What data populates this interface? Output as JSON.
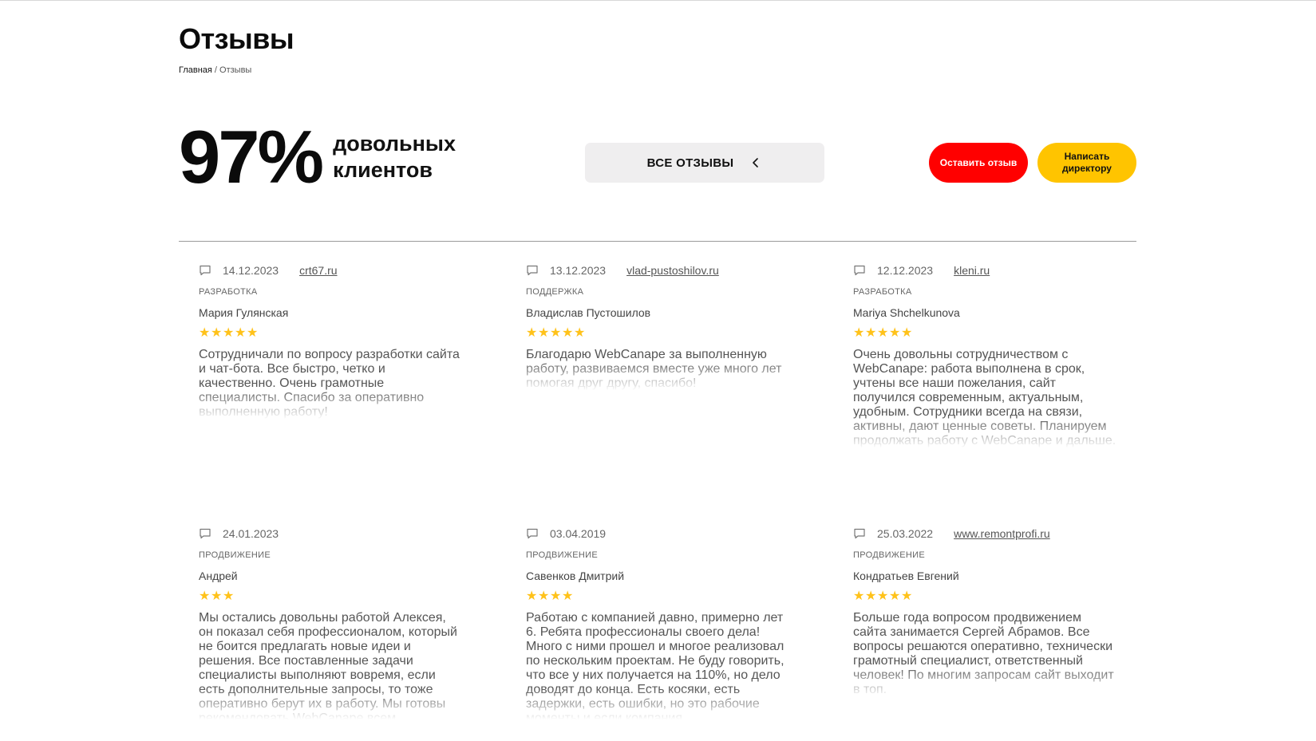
{
  "page": {
    "title": "Отзывы"
  },
  "breadcrumb": {
    "home": "Главная",
    "separator": " / ",
    "current": "Отзывы"
  },
  "stat": {
    "value": "97%",
    "caption_line1": "довольных",
    "caption_line2": "клиентов"
  },
  "filter": {
    "label": "ВСЕ ОТЗЫВЫ",
    "icon": "chevron-left-icon"
  },
  "buttons": {
    "leave_review": "Оставить отзыв",
    "write_director": "Написать директору"
  },
  "colors": {
    "accent_red": "#ff0000",
    "accent_yellow": "#ffc400",
    "star": "#ffc21a",
    "filter_bg": "#efeeef"
  },
  "reviews": [
    {
      "date": "14.12.2023",
      "site": "crt67.ru",
      "category": "РАЗРАБОТКА",
      "author": "Мария Гулянская",
      "rating": 5,
      "text": "Сотрудничали по вопросу разработки сайта и чат-бота. Все быстро, четко и качественно. Очень грамотные специалисты. Спасибо за оперативно выполненную работу!"
    },
    {
      "date": "13.12.2023",
      "site": "vlad-pustoshilov.ru",
      "category": "ПОДДЕРЖКА",
      "author": "Владислав Пустошилов",
      "rating": 5,
      "text": "Благодарю WebCanape за выполненную работу, развиваемся вместе уже много лет помогая друг другу, спасибо!"
    },
    {
      "date": "12.12.2023",
      "site": "kleni.ru",
      "category": "РАЗРАБОТКА",
      "author": "Mariya Shchelkunova",
      "rating": 5,
      "text": "Очень довольны сотрудничеством с WebCanape: работа выполнена в срок, учтены все наши пожелания, сайт получился современным, актуальным, удобным. Сотрудники всегда на связи, активны, дают ценные советы. Планируем продолжать работу с WebCanape и дальше."
    },
    {
      "date": "24.01.2023",
      "site": "",
      "category": "ПРОДВИЖЕНИЕ",
      "author": "Андрей",
      "rating": 3,
      "text": "Мы остались довольны работой Алексея, он показал себя профессионалом, который не боится предлагать новые идеи и решения. Все поставленные задачи специалисты выполняют вовремя, если есть дополнительные запросы, то тоже оперативно берут их в работу. Мы готовы рекомендовать WebCanape всем"
    },
    {
      "date": "03.04.2019",
      "site": "",
      "category": "ПРОДВИЖЕНИЕ",
      "author": "Савенков Дмитрий",
      "rating": 4,
      "text": "Работаю с компанией давно, примерно лет 6. Ребята профессионалы своего дела! Много с ними прошел и многое реализовал по нескольким проектам. Не буду говорить, что все у них получается на 110%, но дело доводят до конца. Есть косяки, есть задержки, есть ошибки, но это рабочие моменты и если компания"
    },
    {
      "date": "25.03.2022",
      "site": "www.remontprofi.ru",
      "category": "ПРОДВИЖЕНИЕ",
      "author": "Кондратьев Евгений",
      "rating": 5,
      "text": "Больше года вопросом продвижением сайта занимается Сергей Абрамов. Все вопросы решаются оперативно, технически грамотный специалист, ответственный человек! По многим запросам сайт выходит в топ."
    }
  ]
}
